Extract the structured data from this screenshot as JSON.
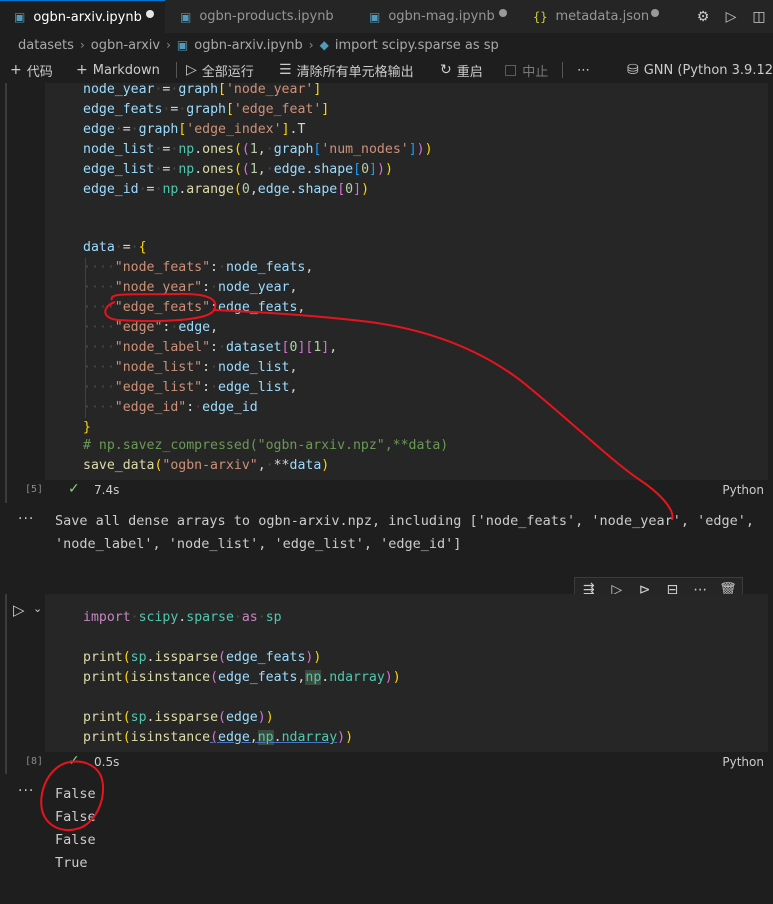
{
  "tabs": [
    {
      "label": "ogbn-arxiv.ipynb",
      "icon": "notebook-icon",
      "active": true
    },
    {
      "label": "ogbn-products.ipynb",
      "icon": "notebook-icon",
      "active": false
    },
    {
      "label": "ogbn-mag.ipynb",
      "icon": "notebook-icon",
      "active": false
    },
    {
      "label": "metadata.json",
      "icon": "json-braces-icon",
      "active": false
    }
  ],
  "window_icons": [
    "gear-icon",
    "play-icon",
    "split-editor-icon"
  ],
  "breadcrumb": {
    "items": [
      "datasets",
      "ogbn-arxiv",
      "ogbn-arxiv.ipynb",
      "import scipy.sparse as sp"
    ]
  },
  "toolbar": {
    "code": "代码",
    "markdown": "Markdown",
    "run_all": "全部运行",
    "clear_outputs": "清除所有单元格输出",
    "restart": "重启",
    "interrupt": "中止",
    "more": "⋯",
    "kernel": "GNN (Python 3.9.12)"
  },
  "cell1": {
    "exec_count": "[5]",
    "time": "7.4s",
    "language": "Python",
    "lines": [
      "node_year = graph['node_year']",
      "edge_feats = graph['edge_feat']",
      "edge = graph['edge_index'].T",
      "node_list = np.ones((1, graph['num_nodes']))",
      "edge_list = np.ones((1, edge.shape[0]))",
      "edge_id = np.arange(0,edge.shape[0])",
      "",
      "",
      "data = {",
      "    \"node_feats\": node_feats,",
      "    \"node_year\": node_year,",
      "    \"edge_feats\":edge_feats,",
      "    \"edge\": edge,",
      "    \"node_label\": dataset[0][1],",
      "    \"node_list\": node_list,",
      "    \"edge_list\": edge_list,",
      "    \"edge_id\": edge_id",
      "}",
      "# np.savez_compressed(\"ogbn-arxiv.npz\",**data)",
      "save_data(\"ogbn-arxiv\", **data)"
    ],
    "output": [
      "Save all dense arrays to ogbn-arxiv.npz, including ['node_feats', 'node_year', 'edge',",
      "'node_label', 'node_list', 'edge_list', 'edge_id']"
    ]
  },
  "cell2": {
    "exec_count": "[8]",
    "time": "0.5s",
    "language": "Python",
    "lines": [
      "import scipy.sparse as sp",
      "",
      "print(sp.issparse(edge_feats))",
      "print(isinstance(edge_feats,np.ndarray))",
      "",
      "print(sp.issparse(edge))",
      "print(isinstance(edge,np.ndarray))"
    ],
    "output": [
      "False",
      "False",
      "False",
      "True"
    ]
  },
  "cell_toolbar_icons": [
    "run-by-line-icon",
    "execute-above-icon",
    "execute-below-icon",
    "split-cell-icon",
    "more-icon",
    "trash-icon"
  ],
  "colors": {
    "background": "#1e1e1e",
    "cell_background": "#262626",
    "accent": "#0078d4",
    "success": "#89d185",
    "annotation": "#e8141d"
  }
}
